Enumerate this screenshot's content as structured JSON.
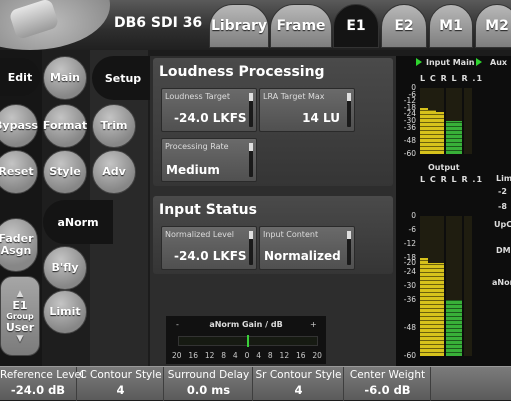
{
  "header": {
    "device_label": "DB6 SDI 36",
    "tabs": [
      {
        "label": "Library",
        "active": false
      },
      {
        "label": "Frame",
        "active": false
      },
      {
        "label": "E1",
        "active": true
      },
      {
        "label": "E2",
        "active": false
      },
      {
        "label": "M1",
        "active": false
      },
      {
        "label": "M2",
        "active": false
      }
    ]
  },
  "left_buttons": {
    "edit": "Edit",
    "bypass": "Bypass",
    "reset": "Reset",
    "fader_assign": "Fader Asgn",
    "group": {
      "label": "E1",
      "sub": "Group",
      "value": "User",
      "up": "▲",
      "down": "▼"
    }
  },
  "mode_buttons": {
    "main": "Main",
    "format": "Format",
    "style": "Style",
    "anorm": "aNorm",
    "bfly": "B'fly",
    "limit": "Limit"
  },
  "sub_buttons": {
    "setup": "Setup",
    "trim": "Trim",
    "adv": "Adv"
  },
  "loudness": {
    "title": "Loudness Processing",
    "target_label": "Loudness Target",
    "target_value": "-24.0 LKFS",
    "lra_label": "LRA Target Max",
    "lra_value": "14 LU",
    "rate_label": "Processing Rate",
    "rate_value": "Medium"
  },
  "input_status": {
    "title": "Input Status",
    "normalized_label": "Normalized Level",
    "normalized_value": "-24.0 LKFS",
    "content_label": "Input Content",
    "content_value": "Normalized"
  },
  "anorm_gain": {
    "title": "aNorm Gain / dB",
    "minus": "-",
    "plus": "+",
    "scale": [
      "20",
      "16",
      "12",
      "8",
      "4",
      "0",
      "4",
      "8",
      "12",
      "16",
      "20"
    ]
  },
  "meters": {
    "input_main_label": "Input Main",
    "aux_label": "Aux",
    "output_label": "Output",
    "channels": [
      "L",
      "C",
      "R",
      "L",
      "R",
      ".1"
    ],
    "scale_top": [
      "0",
      "-6",
      "-12",
      "-18",
      "-24",
      "-30",
      "-36",
      "-48",
      "-60"
    ],
    "scale_bottom": [
      "0",
      "-6",
      "-12",
      "-18",
      "-20",
      "-24",
      "-30",
      "-36",
      "-48",
      "-60"
    ],
    "side_labels": {
      "lim": "Lim",
      "upco": "UpCo",
      "dmi": "DMi",
      "anorm": "aNorm",
      "minus2": "-2",
      "minus8": "-8"
    },
    "input_levels_db": [
      -18,
      -20,
      -22,
      -30,
      -30,
      -60
    ],
    "output_levels_db": [
      -18,
      -20,
      -20,
      -36,
      -36,
      -60
    ],
    "accent_green": "#2fd42f",
    "meter_yellow": "#d6c21c"
  },
  "params": [
    {
      "label": "Reference Level",
      "value": "-24.0 dB"
    },
    {
      "label": "C Contour Style",
      "value": "4"
    },
    {
      "label": "Surround Delay",
      "value": "0.0 ms"
    },
    {
      "label": "Sr Contour Style",
      "value": "4"
    },
    {
      "label": "Center Weight",
      "value": "-6.0 dB"
    }
  ]
}
